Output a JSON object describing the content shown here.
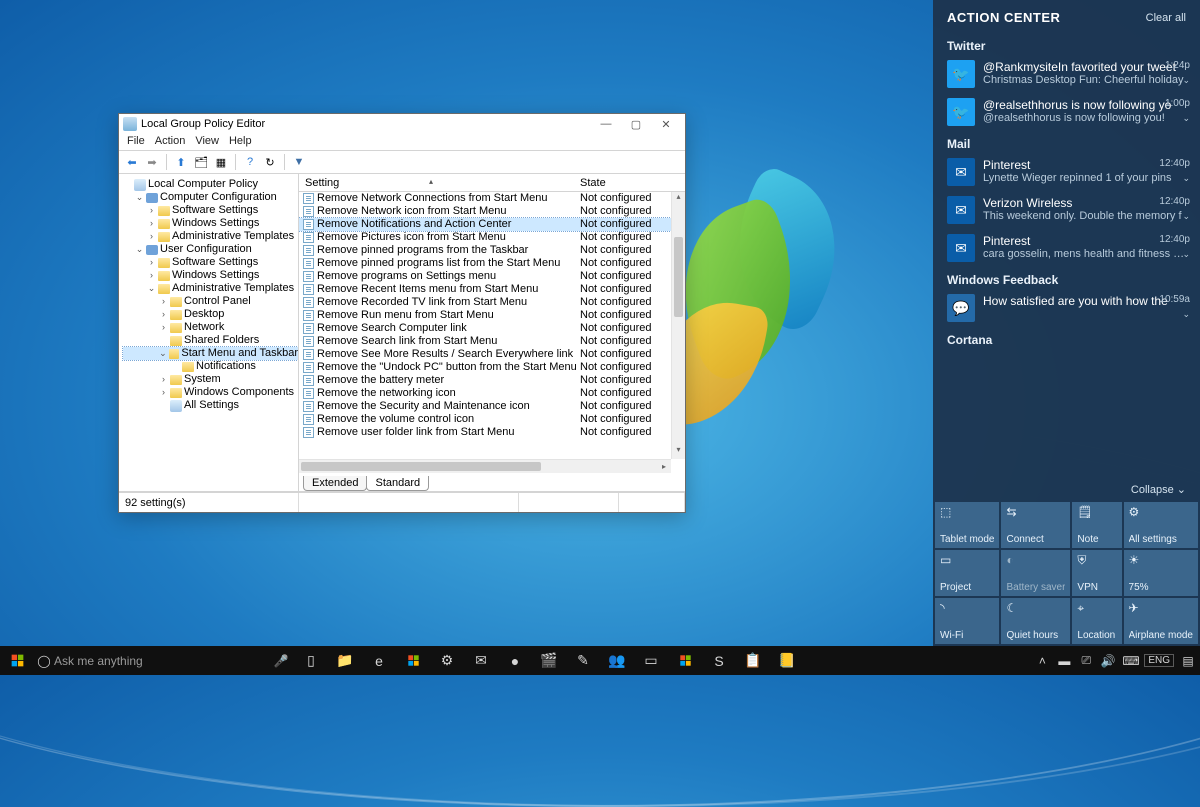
{
  "gpedit": {
    "title": "Local Group Policy Editor",
    "menus": [
      "File",
      "Action",
      "View",
      "Help"
    ],
    "tree": [
      {
        "i": 0,
        "exp": "",
        "ico": "doc",
        "label": "Local Computer Policy"
      },
      {
        "i": 1,
        "exp": "v",
        "ico": "pc",
        "label": "Computer Configuration"
      },
      {
        "i": 2,
        "exp": ">",
        "ico": "folder",
        "label": "Software Settings"
      },
      {
        "i": 2,
        "exp": ">",
        "ico": "folder",
        "label": "Windows Settings"
      },
      {
        "i": 2,
        "exp": ">",
        "ico": "folder",
        "label": "Administrative Templates"
      },
      {
        "i": 1,
        "exp": "v",
        "ico": "pc",
        "label": "User Configuration"
      },
      {
        "i": 2,
        "exp": ">",
        "ico": "folder",
        "label": "Software Settings"
      },
      {
        "i": 2,
        "exp": ">",
        "ico": "folder",
        "label": "Windows Settings"
      },
      {
        "i": 2,
        "exp": "v",
        "ico": "folder",
        "label": "Administrative Templates"
      },
      {
        "i": 3,
        "exp": ">",
        "ico": "folder",
        "label": "Control Panel"
      },
      {
        "i": 3,
        "exp": ">",
        "ico": "folder",
        "label": "Desktop"
      },
      {
        "i": 3,
        "exp": ">",
        "ico": "folder",
        "label": "Network"
      },
      {
        "i": 3,
        "exp": "",
        "ico": "folder",
        "label": "Shared Folders"
      },
      {
        "i": 3,
        "exp": "v",
        "ico": "folder",
        "label": "Start Menu and Taskbar",
        "sel": true
      },
      {
        "i": 4,
        "exp": "",
        "ico": "folder",
        "label": "Notifications"
      },
      {
        "i": 3,
        "exp": ">",
        "ico": "folder",
        "label": "System"
      },
      {
        "i": 3,
        "exp": ">",
        "ico": "folder",
        "label": "Windows Components"
      },
      {
        "i": 3,
        "exp": "",
        "ico": "doc",
        "label": "All Settings"
      }
    ],
    "columns": {
      "setting": "Setting",
      "state": "State"
    },
    "state_default": "Not configured",
    "rows": [
      {
        "s": "Remove Network Connections from Start Menu"
      },
      {
        "s": "Remove Network icon from Start Menu"
      },
      {
        "s": "Remove Notifications and Action Center",
        "sel": true
      },
      {
        "s": "Remove Pictures icon from Start Menu"
      },
      {
        "s": "Remove pinned programs from the Taskbar"
      },
      {
        "s": "Remove pinned programs list from the Start Menu"
      },
      {
        "s": "Remove programs on Settings menu"
      },
      {
        "s": "Remove Recent Items menu from Start Menu"
      },
      {
        "s": "Remove Recorded TV link from Start Menu"
      },
      {
        "s": "Remove Run menu from Start Menu"
      },
      {
        "s": "Remove Search Computer link"
      },
      {
        "s": "Remove Search link from Start Menu"
      },
      {
        "s": "Remove See More Results / Search Everywhere link"
      },
      {
        "s": "Remove the \"Undock PC\" button from the Start Menu"
      },
      {
        "s": "Remove the battery meter"
      },
      {
        "s": "Remove the networking icon"
      },
      {
        "s": "Remove the Security and Maintenance icon"
      },
      {
        "s": "Remove the volume control icon"
      },
      {
        "s": "Remove user folder link from Start Menu"
      }
    ],
    "tabs": {
      "extended": "Extended",
      "standard": "Standard"
    },
    "status": "92 setting(s)"
  },
  "actionCenter": {
    "title": "ACTION CENTER",
    "clear": "Clear all",
    "collapse": "Collapse",
    "groups": [
      {
        "name": "Twitter",
        "items": [
          {
            "icon": "tw",
            "t1": "@RankmysiteIn favorited your tweet",
            "t2": "Christmas Desktop Fun: Cheerful holiday",
            "time": "1:24p"
          },
          {
            "icon": "tw",
            "t1": "@realsethhorus is now following yo",
            "t2": "@realsethhorus is now following you!",
            "time": "1:00p"
          }
        ]
      },
      {
        "name": "Mail",
        "items": [
          {
            "icon": "mail",
            "t1": "Pinterest",
            "t2": "Lynette Wieger repinned 1 of your pins",
            "time": "12:40p"
          },
          {
            "icon": "mail",
            "t1": "Verizon Wireless",
            "t2": "This weekend only. Double the memory f",
            "time": "12:40p"
          },
          {
            "icon": "mail",
            "t1": "Pinterest",
            "t2": "cara gosselin, mens health and fitness and",
            "time": "12:40p"
          }
        ]
      },
      {
        "name": "Windows Feedback",
        "items": [
          {
            "icon": "wf",
            "t1": "How satisfied are you with how the",
            "t2": "",
            "time": "10:59a"
          }
        ]
      },
      {
        "name": "Cortana",
        "items": []
      }
    ],
    "tiles": [
      {
        "icon": "⬚",
        "label": "Tablet mode"
      },
      {
        "icon": "⇆",
        "label": "Connect"
      },
      {
        "icon": "🗒",
        "label": "Note"
      },
      {
        "icon": "⚙",
        "label": "All settings"
      },
      {
        "icon": "▭",
        "label": "Project"
      },
      {
        "icon": "◐",
        "label": "Battery saver",
        "dim": true
      },
      {
        "icon": "⛨",
        "label": "VPN"
      },
      {
        "icon": "☀",
        "label": "75%"
      },
      {
        "icon": "◝",
        "label": "Wi-Fi"
      },
      {
        "icon": "☾",
        "label": "Quiet hours"
      },
      {
        "icon": "⌖",
        "label": "Location"
      },
      {
        "icon": "✈",
        "label": "Airplane mode"
      }
    ]
  },
  "taskbar": {
    "search_placeholder": "Ask me anything",
    "lang": "ENG",
    "icons": [
      "▯",
      "📁",
      "e",
      "⊞",
      "⚙",
      "✉",
      "●",
      "🎬",
      "✎",
      "👥",
      "▭",
      "⊞",
      "S",
      "📋",
      "📒"
    ]
  }
}
